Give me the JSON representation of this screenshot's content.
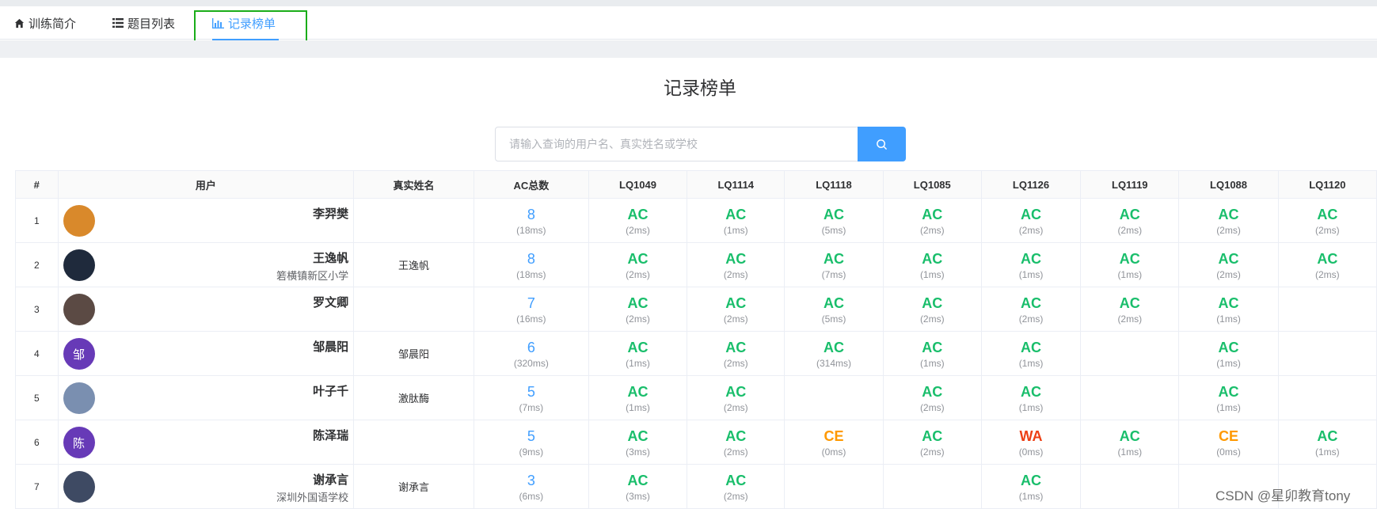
{
  "tabs": [
    {
      "label": "训练简介",
      "icon": "home-icon"
    },
    {
      "label": "题目列表",
      "icon": "list-icon"
    },
    {
      "label": "记录榜单",
      "icon": "bar-chart-icon"
    }
  ],
  "page_title": "记录榜单",
  "search": {
    "placeholder": "请输入查询的用户名、真实姓名或学校",
    "icon": "search-icon"
  },
  "table": {
    "headers": [
      "#",
      "用户",
      "真实姓名",
      "AC总数",
      "LQ1049",
      "LQ1114",
      "LQ1118",
      "LQ1085",
      "LQ1126",
      "LQ1119",
      "LQ1088",
      "LQ1120"
    ],
    "rows": [
      {
        "rank": "1",
        "username": "李羿樊",
        "school": "",
        "realname": "",
        "avatar_text": "",
        "avatar_color": "#d9892b",
        "ac_total": "8",
        "ac_time": "(18ms)",
        "cells": [
          {
            "s": "AC",
            "t": "(2ms)"
          },
          {
            "s": "AC",
            "t": "(1ms)"
          },
          {
            "s": "AC",
            "t": "(5ms)"
          },
          {
            "s": "AC",
            "t": "(2ms)"
          },
          {
            "s": "AC",
            "t": "(2ms)"
          },
          {
            "s": "AC",
            "t": "(2ms)"
          },
          {
            "s": "AC",
            "t": "(2ms)"
          },
          {
            "s": "AC",
            "t": "(2ms)"
          }
        ]
      },
      {
        "rank": "2",
        "username": "王逸帆",
        "school": "箬横镇新区小学",
        "realname": "王逸帆",
        "avatar_text": "",
        "avatar_color": "#1f2a3c",
        "ac_total": "8",
        "ac_time": "(18ms)",
        "cells": [
          {
            "s": "AC",
            "t": "(2ms)"
          },
          {
            "s": "AC",
            "t": "(2ms)"
          },
          {
            "s": "AC",
            "t": "(7ms)"
          },
          {
            "s": "AC",
            "t": "(1ms)"
          },
          {
            "s": "AC",
            "t": "(1ms)"
          },
          {
            "s": "AC",
            "t": "(1ms)"
          },
          {
            "s": "AC",
            "t": "(2ms)"
          },
          {
            "s": "AC",
            "t": "(2ms)"
          }
        ]
      },
      {
        "rank": "3",
        "username": "罗文卿",
        "school": "",
        "realname": "",
        "avatar_text": "",
        "avatar_color": "#5b4a44",
        "ac_total": "7",
        "ac_time": "(16ms)",
        "cells": [
          {
            "s": "AC",
            "t": "(2ms)"
          },
          {
            "s": "AC",
            "t": "(2ms)"
          },
          {
            "s": "AC",
            "t": "(5ms)"
          },
          {
            "s": "AC",
            "t": "(2ms)"
          },
          {
            "s": "AC",
            "t": "(2ms)"
          },
          {
            "s": "AC",
            "t": "(2ms)"
          },
          {
            "s": "AC",
            "t": "(1ms)"
          },
          {
            "s": "",
            "t": ""
          }
        ]
      },
      {
        "rank": "4",
        "username": "邹晨阳",
        "school": "",
        "realname": "邹晨阳",
        "avatar_text": "邹",
        "avatar_color": "#673ab7",
        "ac_total": "6",
        "ac_time": "(320ms)",
        "cells": [
          {
            "s": "AC",
            "t": "(1ms)"
          },
          {
            "s": "AC",
            "t": "(2ms)"
          },
          {
            "s": "AC",
            "t": "(314ms)"
          },
          {
            "s": "AC",
            "t": "(1ms)"
          },
          {
            "s": "AC",
            "t": "(1ms)"
          },
          {
            "s": "",
            "t": ""
          },
          {
            "s": "AC",
            "t": "(1ms)"
          },
          {
            "s": "",
            "t": ""
          }
        ]
      },
      {
        "rank": "5",
        "username": "叶子千",
        "school": "",
        "realname": "激肽酶",
        "avatar_text": "",
        "avatar_color": "#7a8fb0",
        "ac_total": "5",
        "ac_time": "(7ms)",
        "cells": [
          {
            "s": "AC",
            "t": "(1ms)"
          },
          {
            "s": "AC",
            "t": "(2ms)"
          },
          {
            "s": "",
            "t": ""
          },
          {
            "s": "AC",
            "t": "(2ms)"
          },
          {
            "s": "AC",
            "t": "(1ms)"
          },
          {
            "s": "",
            "t": ""
          },
          {
            "s": "AC",
            "t": "(1ms)"
          },
          {
            "s": "",
            "t": ""
          }
        ]
      },
      {
        "rank": "6",
        "username": "陈泽瑞",
        "school": "",
        "realname": "",
        "avatar_text": "陈",
        "avatar_color": "#673ab7",
        "ac_total": "5",
        "ac_time": "(9ms)",
        "cells": [
          {
            "s": "AC",
            "t": "(3ms)"
          },
          {
            "s": "AC",
            "t": "(2ms)"
          },
          {
            "s": "CE",
            "t": "(0ms)"
          },
          {
            "s": "AC",
            "t": "(2ms)"
          },
          {
            "s": "WA",
            "t": "(0ms)"
          },
          {
            "s": "AC",
            "t": "(1ms)"
          },
          {
            "s": "CE",
            "t": "(0ms)"
          },
          {
            "s": "AC",
            "t": "(1ms)"
          }
        ]
      },
      {
        "rank": "7",
        "username": "谢承言",
        "school": "深圳外国语学校",
        "realname": "谢承言",
        "avatar_text": "",
        "avatar_color": "#3e4a63",
        "ac_total": "3",
        "ac_time": "(6ms)",
        "cells": [
          {
            "s": "AC",
            "t": "(3ms)"
          },
          {
            "s": "AC",
            "t": "(2ms)"
          },
          {
            "s": "",
            "t": ""
          },
          {
            "s": "",
            "t": ""
          },
          {
            "s": "AC",
            "t": "(1ms)"
          },
          {
            "s": "",
            "t": ""
          },
          {
            "s": "",
            "t": ""
          },
          {
            "s": "",
            "t": ""
          }
        ]
      }
    ]
  },
  "watermark": "CSDN @星卯教育tony",
  "colors": {
    "accent": "#409eff",
    "ac": "#19be6b",
    "ce": "#ff9900",
    "wa": "#ed3f14",
    "highlight_box": "#1aad19"
  }
}
